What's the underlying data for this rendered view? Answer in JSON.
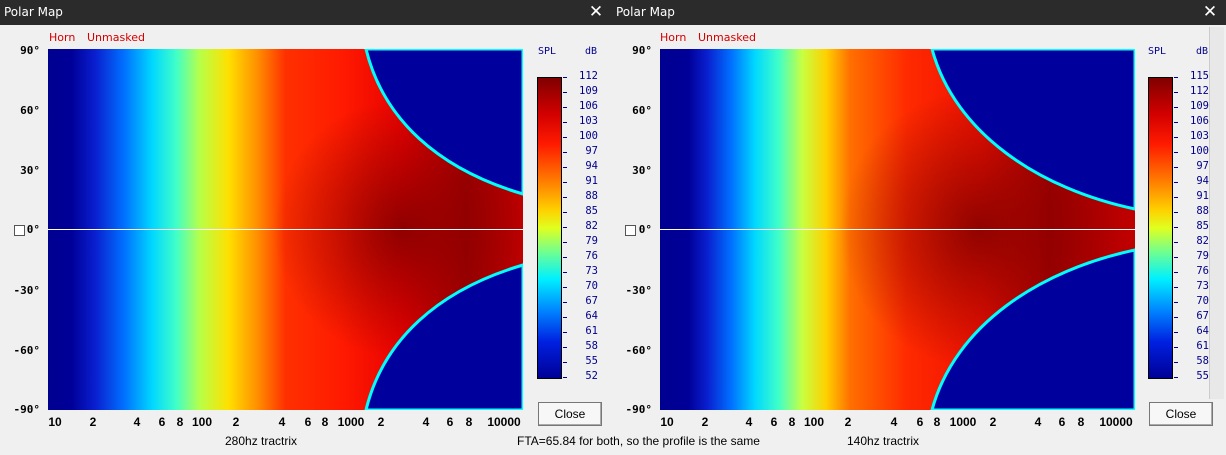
{
  "left_window": {
    "title": "Polar Map",
    "tags": [
      "Horn",
      "Unmasked"
    ],
    "y_ticks": [
      "90°",
      "60°",
      "30°",
      "0°",
      "-30°",
      "-60°",
      "-90°"
    ],
    "x_ticks": [
      "10",
      "2",
      "4",
      "6",
      "8",
      "100",
      "2",
      "4",
      "6",
      "8",
      "1000",
      "2",
      "4",
      "6",
      "8",
      "10000"
    ],
    "colorbar": {
      "title": "SPL",
      "unit": "dB",
      "values": [
        "112",
        "109",
        "106",
        "103",
        "100",
        "97",
        "94",
        "91",
        "88",
        "85",
        "82",
        "79",
        "76",
        "73",
        "70",
        "67",
        "64",
        "61",
        "58",
        "55",
        "52"
      ]
    },
    "close_label": "Close",
    "caption": "280hz tractrix"
  },
  "right_window": {
    "title": "Polar Map",
    "tags": [
      "Horn",
      "Unmasked"
    ],
    "y_ticks": [
      "90°",
      "60°",
      "30°",
      "0°",
      "-30°",
      "-60°",
      "-90°"
    ],
    "x_ticks": [
      "10",
      "2",
      "4",
      "6",
      "8",
      "100",
      "2",
      "4",
      "6",
      "8",
      "1000",
      "2",
      "4",
      "6",
      "8",
      "10000"
    ],
    "colorbar": {
      "title": "SPL",
      "unit": "dB",
      "values": [
        "115",
        "112",
        "109",
        "106",
        "103",
        "100",
        "97",
        "94",
        "91",
        "88",
        "85",
        "82",
        "79",
        "76",
        "73",
        "70",
        "67",
        "64",
        "61",
        "58",
        "55"
      ]
    },
    "close_label": "Close",
    "caption": "140hz tractrix"
  },
  "center_note": "FTA=65.84 for both, so the profile is the same",
  "chart_data": [
    {
      "type": "heatmap",
      "title": "Polar Map",
      "subtitle": "280hz tractrix",
      "xlabel": "",
      "ylabel": "",
      "x_scale": "log",
      "xlim": [
        10,
        20000
      ],
      "y_ticks": [
        90,
        60,
        30,
        0,
        -30,
        -60,
        -90
      ],
      "ylim": [
        -90,
        90
      ],
      "colorbar": {
        "label": "SPL dB",
        "min": 52,
        "max": 112
      },
      "peak_spl": 112,
      "beaming_onset_hz": 1500
    },
    {
      "type": "heatmap",
      "title": "Polar Map",
      "subtitle": "140hz tractrix",
      "xlabel": "",
      "ylabel": "",
      "x_scale": "log",
      "xlim": [
        10,
        20000
      ],
      "y_ticks": [
        90,
        60,
        30,
        0,
        -30,
        -60,
        -90
      ],
      "ylim": [
        -90,
        90
      ],
      "colorbar": {
        "label": "SPL dB",
        "min": 55,
        "max": 115
      },
      "peak_spl": 115,
      "beaming_onset_hz": 700
    }
  ]
}
